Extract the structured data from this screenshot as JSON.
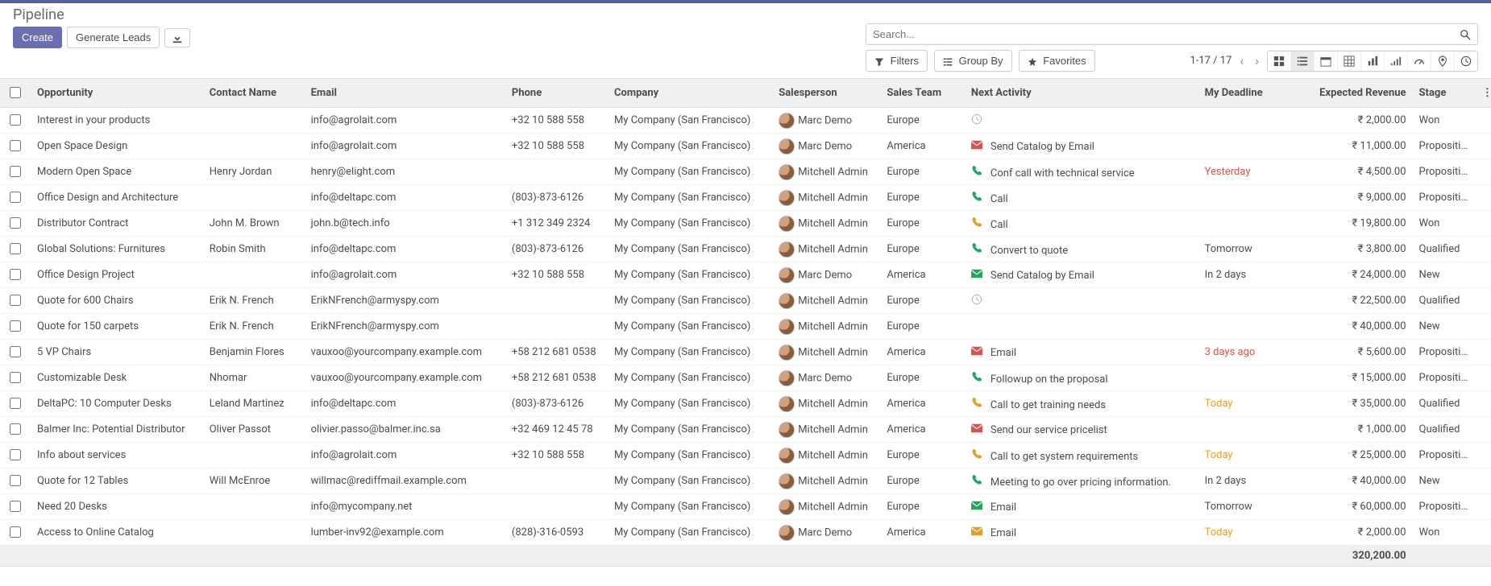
{
  "breadcrumb": {
    "title": "Pipeline"
  },
  "buttons": {
    "create": "Create",
    "generate_leads": "Generate Leads"
  },
  "search": {
    "placeholder": "Search..."
  },
  "filters": {
    "filters": "Filters",
    "groupby": "Group By",
    "favorites": "Favorites"
  },
  "pager": {
    "text": "1-17 / 17"
  },
  "columns": {
    "opportunity": "Opportunity",
    "contact": "Contact Name",
    "email": "Email",
    "phone": "Phone",
    "company": "Company",
    "salesperson": "Salesperson",
    "team": "Sales Team",
    "activity": "Next Activity",
    "deadline": "My Deadline",
    "revenue": "Expected Revenue",
    "stage": "Stage"
  },
  "rows": [
    {
      "opportunity": "Interest in your products",
      "contact": "",
      "email": "info@agrolait.com",
      "phone": "+32 10 588 558",
      "company": "My Company (San Francisco)",
      "salesperson": "Marc Demo",
      "team": "Europe",
      "activity_icon": "clock",
      "activity": "",
      "deadline": "",
      "deadline_class": "",
      "revenue": "₹ 2,000.00",
      "stage": "Won"
    },
    {
      "opportunity": "Open Space Design",
      "contact": "",
      "email": "info@agrolait.com",
      "phone": "+32 10 588 558",
      "company": "My Company (San Francisco)",
      "salesperson": "Marc Demo",
      "team": "America",
      "activity_icon": "mail-red",
      "activity": "Send Catalog by Email",
      "deadline": "",
      "deadline_class": "",
      "revenue": "₹ 11,000.00",
      "stage": "Proposition"
    },
    {
      "opportunity": "Modern Open Space",
      "contact": "Henry Jordan",
      "email": "henry@elight.com",
      "phone": "",
      "company": "My Company (San Francisco)",
      "salesperson": "Mitchell Admin",
      "team": "Europe",
      "activity_icon": "phone-green",
      "activity": "Conf call with technical service",
      "deadline": "Yesterday",
      "deadline_class": "dl-red",
      "revenue": "₹ 4,500.00",
      "stage": "Proposition"
    },
    {
      "opportunity": "Office Design and Architecture",
      "contact": "",
      "email": "info@deltapc.com",
      "phone": "(803)-873-6126",
      "company": "My Company (San Francisco)",
      "salesperson": "Mitchell Admin",
      "team": "Europe",
      "activity_icon": "phone-green",
      "activity": "Call",
      "deadline": "",
      "deadline_class": "",
      "revenue": "₹ 9,000.00",
      "stage": "Proposition"
    },
    {
      "opportunity": "Distributor Contract",
      "contact": "John M. Brown",
      "email": "john.b@tech.info",
      "phone": "+1 312 349 2324",
      "company": "My Company (San Francisco)",
      "salesperson": "Mitchell Admin",
      "team": "Europe",
      "activity_icon": "phone-orange",
      "activity": "Call",
      "deadline": "",
      "deadline_class": "",
      "revenue": "₹ 19,800.00",
      "stage": "Won"
    },
    {
      "opportunity": "Global Solutions: Furnitures",
      "contact": "Robin Smith",
      "email": "info@deltapc.com",
      "phone": "(803)-873-6126",
      "company": "My Company (San Francisco)",
      "salesperson": "Mitchell Admin",
      "team": "Europe",
      "activity_icon": "phone-green",
      "activity": "Convert to quote",
      "deadline": "Tomorrow",
      "deadline_class": "",
      "revenue": "₹ 3,800.00",
      "stage": "Qualified"
    },
    {
      "opportunity": "Office Design Project",
      "contact": "",
      "email": "info@agrolait.com",
      "phone": "+32 10 588 558",
      "company": "My Company (San Francisco)",
      "salesperson": "Marc Demo",
      "team": "America",
      "activity_icon": "mail-green",
      "activity": "Send Catalog by Email",
      "deadline": "In 2 days",
      "deadline_class": "",
      "revenue": "₹ 24,000.00",
      "stage": "New"
    },
    {
      "opportunity": "Quote for 600 Chairs",
      "contact": "Erik N. French",
      "email": "ErikNFrench@armyspy.com",
      "phone": "",
      "company": "My Company (San Francisco)",
      "salesperson": "Mitchell Admin",
      "team": "Europe",
      "activity_icon": "clock",
      "activity": "",
      "deadline": "",
      "deadline_class": "",
      "revenue": "₹ 22,500.00",
      "stage": "Qualified"
    },
    {
      "opportunity": "Quote for 150 carpets",
      "contact": "Erik N. French",
      "email": "ErikNFrench@armyspy.com",
      "phone": "",
      "company": "My Company (San Francisco)",
      "salesperson": "Mitchell Admin",
      "team": "Europe",
      "activity_icon": "",
      "activity": "",
      "deadline": "",
      "deadline_class": "",
      "revenue": "₹ 40,000.00",
      "stage": "New"
    },
    {
      "opportunity": "5 VP Chairs",
      "contact": "Benjamin Flores",
      "email": "vauxoo@yourcompany.example.com",
      "phone": "+58 212 681 0538",
      "company": "My Company (San Francisco)",
      "salesperson": "Mitchell Admin",
      "team": "America",
      "activity_icon": "mail-red",
      "activity": "Email",
      "deadline": "3 days ago",
      "deadline_class": "dl-red",
      "revenue": "₹ 5,600.00",
      "stage": "Proposition"
    },
    {
      "opportunity": "Customizable Desk",
      "contact": "Nhomar",
      "email": "vauxoo@yourcompany.example.com",
      "phone": "+58 212 681 0538",
      "company": "My Company (San Francisco)",
      "salesperson": "Marc Demo",
      "team": "Europe",
      "activity_icon": "phone-green",
      "activity": "Followup on the proposal",
      "deadline": "",
      "deadline_class": "",
      "revenue": "₹ 15,000.00",
      "stage": "Proposition"
    },
    {
      "opportunity": "DeltaPC: 10 Computer Desks",
      "contact": "Leland Martinez",
      "email": "info@deltapc.com",
      "phone": "(803)-873-6126",
      "company": "My Company (San Francisco)",
      "salesperson": "Mitchell Admin",
      "team": "America",
      "activity_icon": "phone-orange",
      "activity": "Call to get training needs",
      "deadline": "Today",
      "deadline_class": "dl-orange",
      "revenue": "₹ 35,000.00",
      "stage": "Qualified"
    },
    {
      "opportunity": "Balmer Inc: Potential Distributor",
      "contact": "Oliver Passot",
      "email": "olivier.passo@balmer.inc.sa",
      "phone": "+32 469 12 45 78",
      "company": "My Company (San Francisco)",
      "salesperson": "Mitchell Admin",
      "team": "America",
      "activity_icon": "mail-red",
      "activity": "Send our service pricelist",
      "deadline": "",
      "deadline_class": "",
      "revenue": "₹ 1,000.00",
      "stage": "Qualified"
    },
    {
      "opportunity": "Info about services",
      "contact": "",
      "email": "info@agrolait.com",
      "phone": "+32 10 588 558",
      "company": "My Company (San Francisco)",
      "salesperson": "Mitchell Admin",
      "team": "Europe",
      "activity_icon": "phone-orange",
      "activity": "Call to get system requirements",
      "deadline": "Today",
      "deadline_class": "dl-orange",
      "revenue": "₹ 25,000.00",
      "stage": "Proposition"
    },
    {
      "opportunity": "Quote for 12 Tables",
      "contact": "Will McEnroe",
      "email": "willmac@rediffmail.example.com",
      "phone": "",
      "company": "My Company (San Francisco)",
      "salesperson": "Mitchell Admin",
      "team": "Europe",
      "activity_icon": "phone-green",
      "activity": "Meeting to go over pricing information.",
      "deadline": "In 2 days",
      "deadline_class": "",
      "revenue": "₹ 40,000.00",
      "stage": "New"
    },
    {
      "opportunity": "Need 20 Desks",
      "contact": "",
      "email": "info@mycompany.net",
      "phone": "",
      "company": "My Company (San Francisco)",
      "salesperson": "Mitchell Admin",
      "team": "Europe",
      "activity_icon": "mail-green",
      "activity": "Email",
      "deadline": "Tomorrow",
      "deadline_class": "",
      "revenue": "₹ 60,000.00",
      "stage": "Proposition"
    },
    {
      "opportunity": "Access to Online Catalog",
      "contact": "",
      "email": "lumber-inv92@example.com",
      "phone": "(828)-316-0593",
      "company": "My Company (San Francisco)",
      "salesperson": "Marc Demo",
      "team": "America",
      "activity_icon": "mail-orange",
      "activity": "Email",
      "deadline": "Today",
      "deadline_class": "dl-orange",
      "revenue": "₹ 2,000.00",
      "stage": "Won"
    }
  ],
  "total_revenue": "320,200.00"
}
